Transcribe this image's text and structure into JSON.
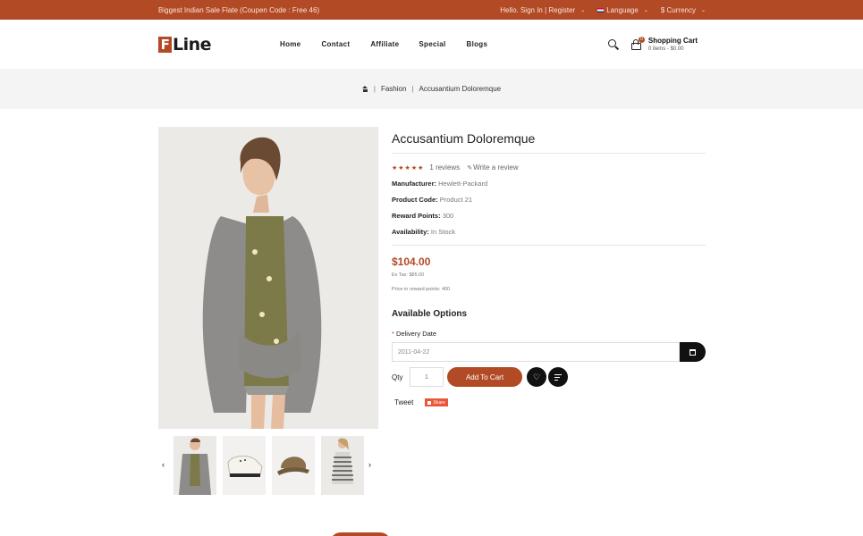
{
  "topbar": {
    "promo": "Biggest Indian Sale Flate (Coupen Code : Free 46)",
    "account": "Hello. Sign In | Register",
    "language": "Language",
    "currency": "$ Currency"
  },
  "header": {
    "logo_mark": "F",
    "logo_text": "Line",
    "nav": [
      "Home",
      "Contact",
      "Affiliate",
      "Special",
      "Blogs"
    ],
    "cart_title": "Shopping Cart",
    "cart_summary": "0 items - $0.00",
    "cart_count": "0"
  },
  "breadcrumb": {
    "items": [
      "Fashion",
      "Accusantium Doloremque"
    ]
  },
  "product": {
    "title": "Accusantium Doloremque",
    "rating": 5,
    "stars": "★★★★★",
    "reviews": "1 reviews",
    "write_review": "Write a review",
    "specs": [
      {
        "label": "Manufacturer:",
        "value": "Hewlett-Packard"
      },
      {
        "label": "Product Code:",
        "value": "Product 21"
      },
      {
        "label": "Reward Points:",
        "value": "300"
      },
      {
        "label": "Availability:",
        "value": "In Stock"
      }
    ],
    "price": "$104.00",
    "ex_tax": "Ex Tax: $85.00",
    "reward_price": "Price in reward points: 400",
    "options_title": "Available Options",
    "delivery_label": "Delivery Date",
    "delivery_value": "2011-04-22",
    "qty_label": "Qty",
    "qty_value": "1",
    "add_to_cart": "Add To Cart",
    "tweet": "Tweet",
    "share": "Share"
  },
  "colors": {
    "accent": "#b24a25",
    "dark": "#111111",
    "breadcrumb_bg": "#f4f4f4"
  }
}
